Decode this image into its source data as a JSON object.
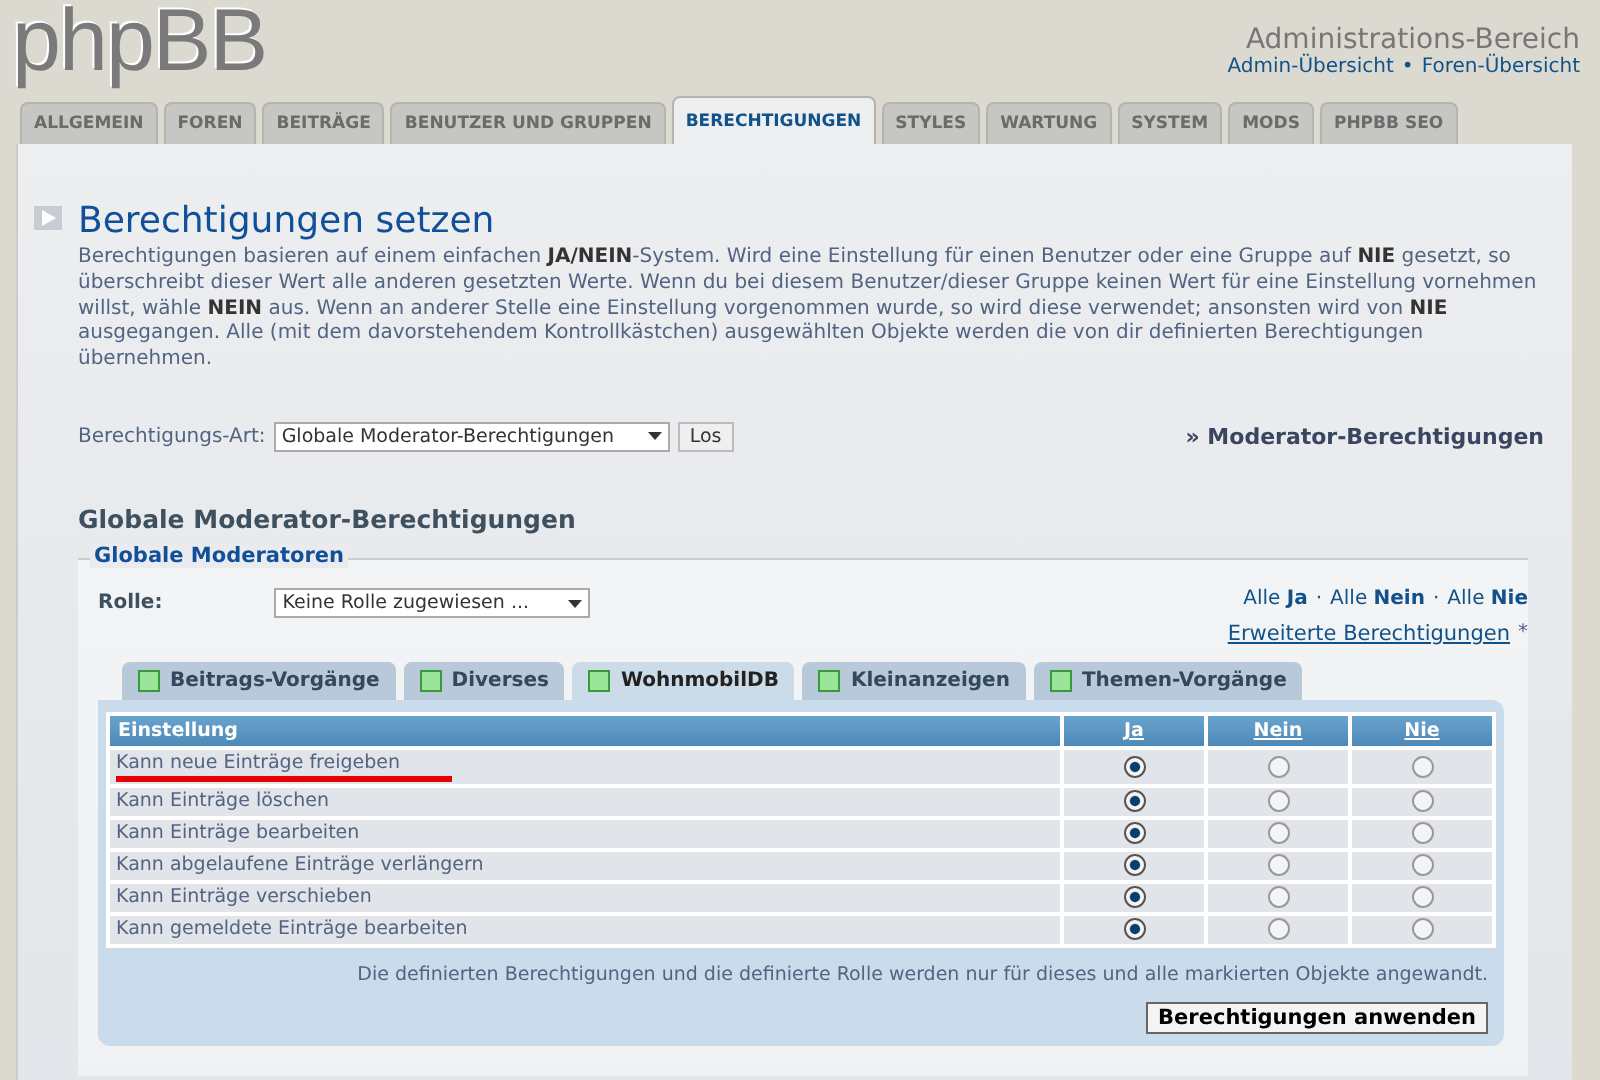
{
  "header": {
    "logo": "phpBB",
    "title": "Administrations-Bereich",
    "links": [
      "Admin-Übersicht",
      "Foren-Übersicht"
    ],
    "separator": "•"
  },
  "tabs": [
    {
      "label": "ALLGEMEIN",
      "selected": false
    },
    {
      "label": "FOREN",
      "selected": false
    },
    {
      "label": "BEITRÄGE",
      "selected": false
    },
    {
      "label": "BENUTZER UND GRUPPEN",
      "selected": false
    },
    {
      "label": "BERECHTIGUNGEN",
      "selected": true
    },
    {
      "label": "STYLES",
      "selected": false
    },
    {
      "label": "WARTUNG",
      "selected": false
    },
    {
      "label": "SYSTEM",
      "selected": false
    },
    {
      "label": "MODS",
      "selected": false
    },
    {
      "label": "PHPBB SEO",
      "selected": false
    }
  ],
  "page": {
    "title": "Berechtigungen setzen",
    "intro": "Berechtigungen basieren auf einem einfachen **JA/NEIN**-System. Wird eine Einstellung für einen Benutzer oder eine Gruppe auf **NIE** gesetzt, so überschreibt dieser Wert alle anderen gesetzten Werte. Wenn du bei diesem Benutzer/dieser Gruppe keinen Wert für eine Einstellung vornehmen willst, wähle **NEIN** aus. Wenn an anderer Stelle eine Einstellung vorgenommen wurde, so wird diese verwendet; ansonsten wird von **NIE** ausgegangen. Alle (mit dem davorstehendem Kontrollkästchen) ausgewählten Objekte werden die von dir definierten Berechtigungen übernehmen.",
    "type_label": "Berechtigungs-Art:",
    "type_value": "Globale Moderator-Berechtigungen",
    "go_button": "Los",
    "side_link": "» Moderator-Berechtigungen"
  },
  "section": {
    "title": "Globale Moderator-Berechtigungen",
    "legend": "Globale Moderatoren",
    "role_label": "Rolle:",
    "role_value": "Keine Rolle zugewiesen ...",
    "quick_links": [
      {
        "prefix": "Alle ",
        "bold": "Ja"
      },
      {
        "prefix": "Alle ",
        "bold": "Nein"
      },
      {
        "prefix": "Alle ",
        "bold": "Nie"
      }
    ],
    "quick_sep": "·",
    "advanced_link": "Erweiterte Berechtigungen",
    "advanced_mark": "*"
  },
  "cat_tabs": [
    {
      "label": "Beitrags-Vorgänge",
      "selected": false
    },
    {
      "label": "Diverses",
      "selected": false
    },
    {
      "label": "WohnmobilDB",
      "selected": true
    },
    {
      "label": "Kleinanzeigen",
      "selected": false
    },
    {
      "label": "Themen-Vorgänge",
      "selected": false
    }
  ],
  "table": {
    "columns": [
      "Einstellung",
      "Ja",
      "Nein",
      "Nie"
    ],
    "rows": [
      {
        "label": "Kann neue Einträge freigeben",
        "highlighted": true,
        "options": [
          {
            "selected": true
          },
          {
            "selected": false
          },
          {
            "selected": false
          }
        ]
      },
      {
        "label": "Kann Einträge löschen",
        "highlighted": false,
        "options": [
          {
            "selected": true
          },
          {
            "selected": false
          },
          {
            "selected": false
          }
        ]
      },
      {
        "label": "Kann Einträge bearbeiten",
        "highlighted": false,
        "options": [
          {
            "selected": true
          },
          {
            "selected": false
          },
          {
            "selected": false
          }
        ]
      },
      {
        "label": "Kann abgelaufene Einträge verlängern",
        "highlighted": false,
        "options": [
          {
            "selected": true
          },
          {
            "selected": false
          },
          {
            "selected": false
          }
        ]
      },
      {
        "label": "Kann Einträge verschieben",
        "highlighted": false,
        "options": [
          {
            "selected": true
          },
          {
            "selected": false
          },
          {
            "selected": false
          }
        ]
      },
      {
        "label": "Kann gemeldete Einträge bearbeiten",
        "highlighted": false,
        "options": [
          {
            "selected": true
          },
          {
            "selected": false
          },
          {
            "selected": false
          }
        ]
      }
    ]
  },
  "note": "Die definierten Berechtigungen und die definierte Rolle werden nur für dieses und alle markierten Objekte angewandt.",
  "apply_button": "Berechtigungen anwenden"
}
